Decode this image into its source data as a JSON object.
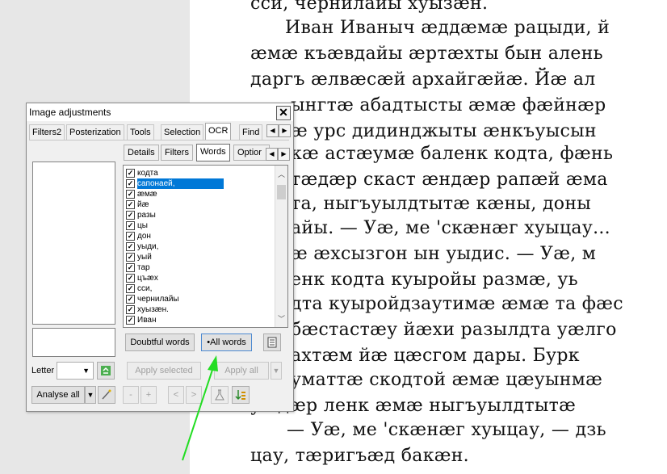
{
  "document": {
    "lines": [
      "сси, чернилайы хуызæн.",
      "Иван Иваныч æддæмæ рацыди, й",
      "æмæ къæвдайы æртæхты бын алень",
      "даргъ æлвæсæй архайгæйæ. Йæ ал",
      "ынгтæ абадтысты æмæ фæйнæр",
      "æ урс дидинджыты æнкъуысын",
      "кæ астæумæ баленк кодта, фæнь",
      "тæдæр скаст æндæр рапæй æма",
      "та, ныгъуылдтытæ кæны, доны",
      "айы. — Уæ, ме 'скæнæг хуыцау...",
      "æ æхсызгон ын уыдис. — Уæ, м",
      "енк кодта куыройы размæ, уь",
      "дта куыройдзаутимæ æмæ та фæс",
      "бæстастæу йæхи разылдта уæлго",
      "ахтæм йæ цæсгом дары. Бурк",
      "уматтæ скодтой æмæ цæуынмæ",
      "уæдæр ленк æмæ ныгъуылдтытæ",
      "— Уæ, ме 'скæнæг хуыцау, — дзь",
      "цау, тæригъæд бакæн."
    ]
  },
  "dialog": {
    "title": "Image adjustments",
    "close": "✕",
    "tabs": [
      "Filters2",
      "Posterization",
      "Tools",
      "Selection",
      "OCR",
      "Find"
    ],
    "active_tab": "OCR",
    "subtabs": [
      "Details",
      "Filters",
      "Words",
      "Optior"
    ],
    "active_subtab": "Words",
    "words": [
      "кодта",
      "сапонаей,",
      "æмæ",
      "йæ",
      "разы",
      "цы",
      "дон",
      "уыди,",
      "уый",
      "тар",
      "цъæх",
      "сси,",
      "чернилайы",
      "хуызæн.",
      "Иван"
    ],
    "selected_word": "сапонаей,",
    "doubtful_words_label": "Doubtful words",
    "all_words_label": "•All words",
    "letter_label": "Letter",
    "apply_selected_label": "Apply selected",
    "apply_all_label": "Apply all",
    "analyse_all_label": "Analyse all",
    "minus_label": "-",
    "plus_label": "+",
    "prev_label": "<",
    "next_label": ">"
  },
  "colors": {
    "selection": "#0078d7",
    "annotation_arrow": "#22dd22"
  }
}
